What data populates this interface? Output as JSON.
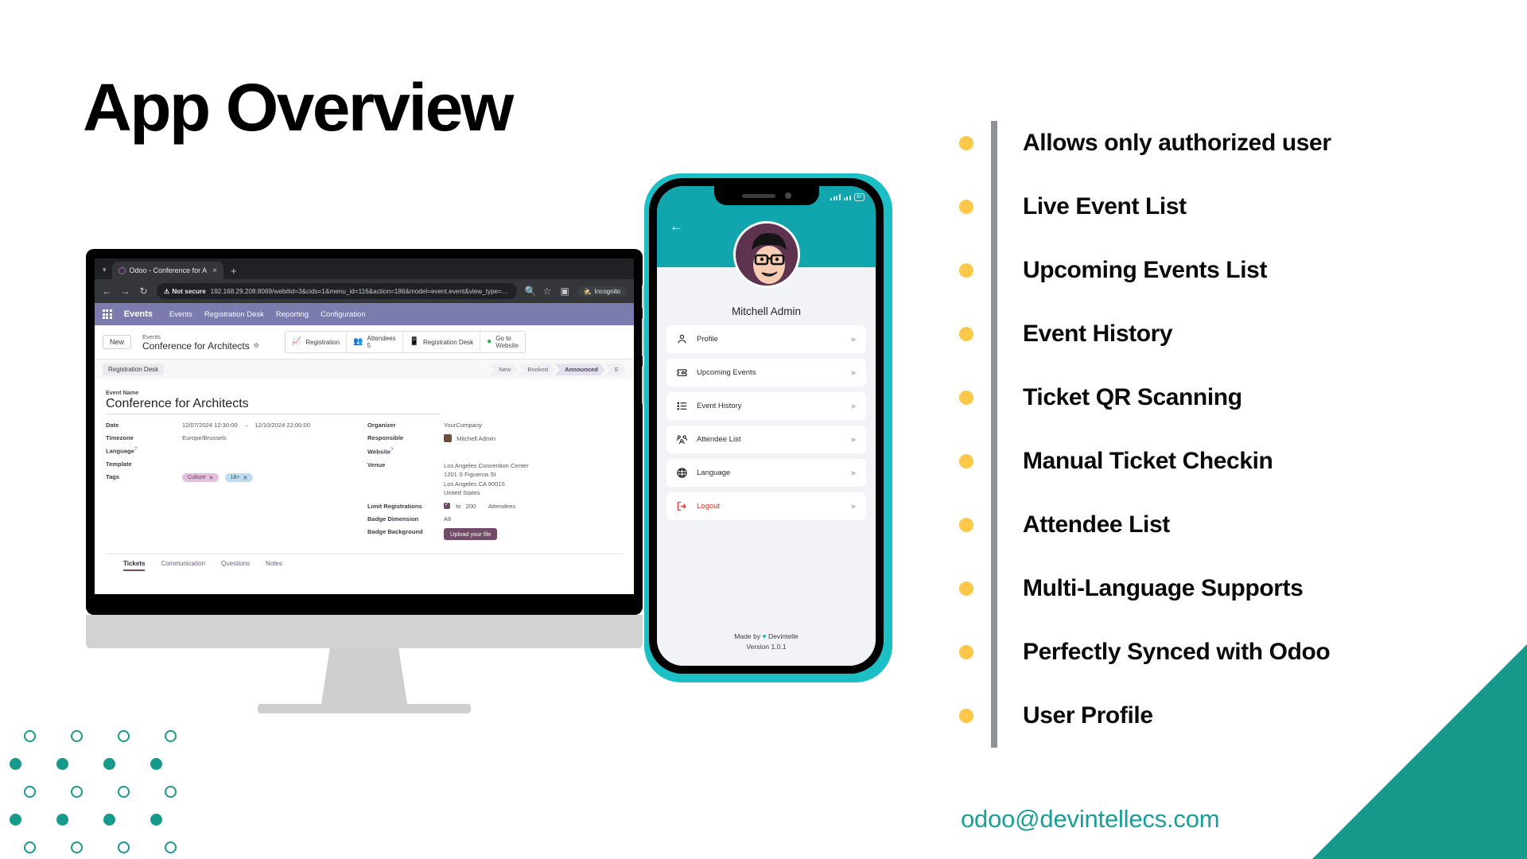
{
  "slide": {
    "title": "App Overview",
    "email": "odoo@devintellecs.com",
    "accent_teal": "#17998c",
    "accent_bullet": "#fcc84a",
    "rail_color": "#8e9195"
  },
  "features": [
    {
      "label": "Allows only authorized user"
    },
    {
      "label": "Live Event List"
    },
    {
      "label": "Upcoming Events List"
    },
    {
      "label": "Event History"
    },
    {
      "label": "Ticket QR Scanning"
    },
    {
      "label": "Manual Ticket Checkin"
    },
    {
      "label": "Attendee List"
    },
    {
      "label": "Multi-Language Supports"
    },
    {
      "label": "Perfectly Synced with Odoo"
    },
    {
      "label": "User Profile"
    }
  ],
  "phone": {
    "status": {
      "battery": "87"
    },
    "back_icon": "arrow-left-icon",
    "user_name": "Mitchell Admin",
    "menu": [
      {
        "label": "Profile",
        "icon": "person-icon",
        "danger": false
      },
      {
        "label": "Upcoming Events",
        "icon": "ticket-icon",
        "danger": false
      },
      {
        "label": "Event History",
        "icon": "list-icon",
        "danger": false
      },
      {
        "label": "Attendee List",
        "icon": "people-icon",
        "danger": false
      },
      {
        "label": "Language",
        "icon": "globe-icon",
        "danger": false
      },
      {
        "label": "Logout",
        "icon": "logout-icon",
        "danger": true
      }
    ],
    "footer": {
      "made_by_prefix": "Made by",
      "heart": "♥",
      "brand": "Devintelle",
      "version": "Version 1.0.1"
    }
  },
  "desktop": {
    "browser": {
      "tab_title": "Odoo - Conference for A",
      "tab_close": "×",
      "new_tab": "+",
      "back": "←",
      "forward": "→",
      "reload": "↻",
      "not_secure": "Not secure",
      "url": "192.168.29.208:8069/web#id=3&cids=1&menu_id=116&action=186&model=event.event&view_type=form",
      "incognito": "Incognito"
    },
    "odoo": {
      "brand": "Events",
      "menus": [
        "Events",
        "Registration Desk",
        "Reporting",
        "Configuration"
      ],
      "control_panel": {
        "new_button": "New",
        "breadcrumb_parent": "Events",
        "breadcrumb_current": "Conference for Architects",
        "stat_buttons": [
          {
            "label": "Registration",
            "sub": "",
            "icon": "chart-line-icon"
          },
          {
            "label": "Attendees",
            "sub": "5",
            "icon": "people-group-icon"
          },
          {
            "label": "Registration Desk",
            "sub": "",
            "icon": "mobile-icon"
          },
          {
            "label": "Go to",
            "sub": "Website",
            "icon": "globe-green-icon"
          }
        ]
      },
      "sheet_tag": "Registration Desk",
      "status_steps": [
        {
          "label": "New",
          "active": false
        },
        {
          "label": "Booked",
          "active": false
        },
        {
          "label": "Announced",
          "active": true
        },
        {
          "label": "E",
          "active": false
        }
      ],
      "form": {
        "event_name_label": "Event Name",
        "event_name_value": "Conference for Architects",
        "left_fields": [
          {
            "key": "Date",
            "value": "12/07/2024 12:30:00",
            "value2": "12/10/2024 22:00:00",
            "arrow": "→"
          },
          {
            "key": "Timezone",
            "value": "Europe/Brussels"
          },
          {
            "key": "Language",
            "value": "",
            "sup": "?"
          },
          {
            "key": "Template",
            "value": ""
          },
          {
            "key": "Tags",
            "value": ""
          }
        ],
        "tags": [
          {
            "label": "Culture",
            "x": "✕"
          },
          {
            "label": "18+",
            "x": "✕"
          }
        ],
        "right_fields": [
          {
            "key": "Organizer",
            "value": "YourCompany"
          },
          {
            "key": "Responsible",
            "value": "Mitchell Admin",
            "avatar": true
          },
          {
            "key": "Website",
            "value": "",
            "sup": "?"
          }
        ],
        "venue": {
          "key": "Venue",
          "lines": [
            "Los Angeles Convention Center",
            "1201 S Figueroa St",
            "Los Angeles CA 90015",
            "United States"
          ]
        },
        "limit": {
          "key": "Limit Registrations",
          "to": "to",
          "count": "200",
          "unit": "Attendees"
        },
        "badge_dimension": {
          "key": "Badge Dimension",
          "value": "A6"
        },
        "badge_background": {
          "key": "Badge Background",
          "button": "Upload your file"
        }
      },
      "tabs": [
        {
          "label": "Tickets",
          "active": true
        },
        {
          "label": "Communication",
          "active": false
        },
        {
          "label": "Questions",
          "active": false
        },
        {
          "label": "Notes",
          "active": false
        }
      ]
    }
  }
}
